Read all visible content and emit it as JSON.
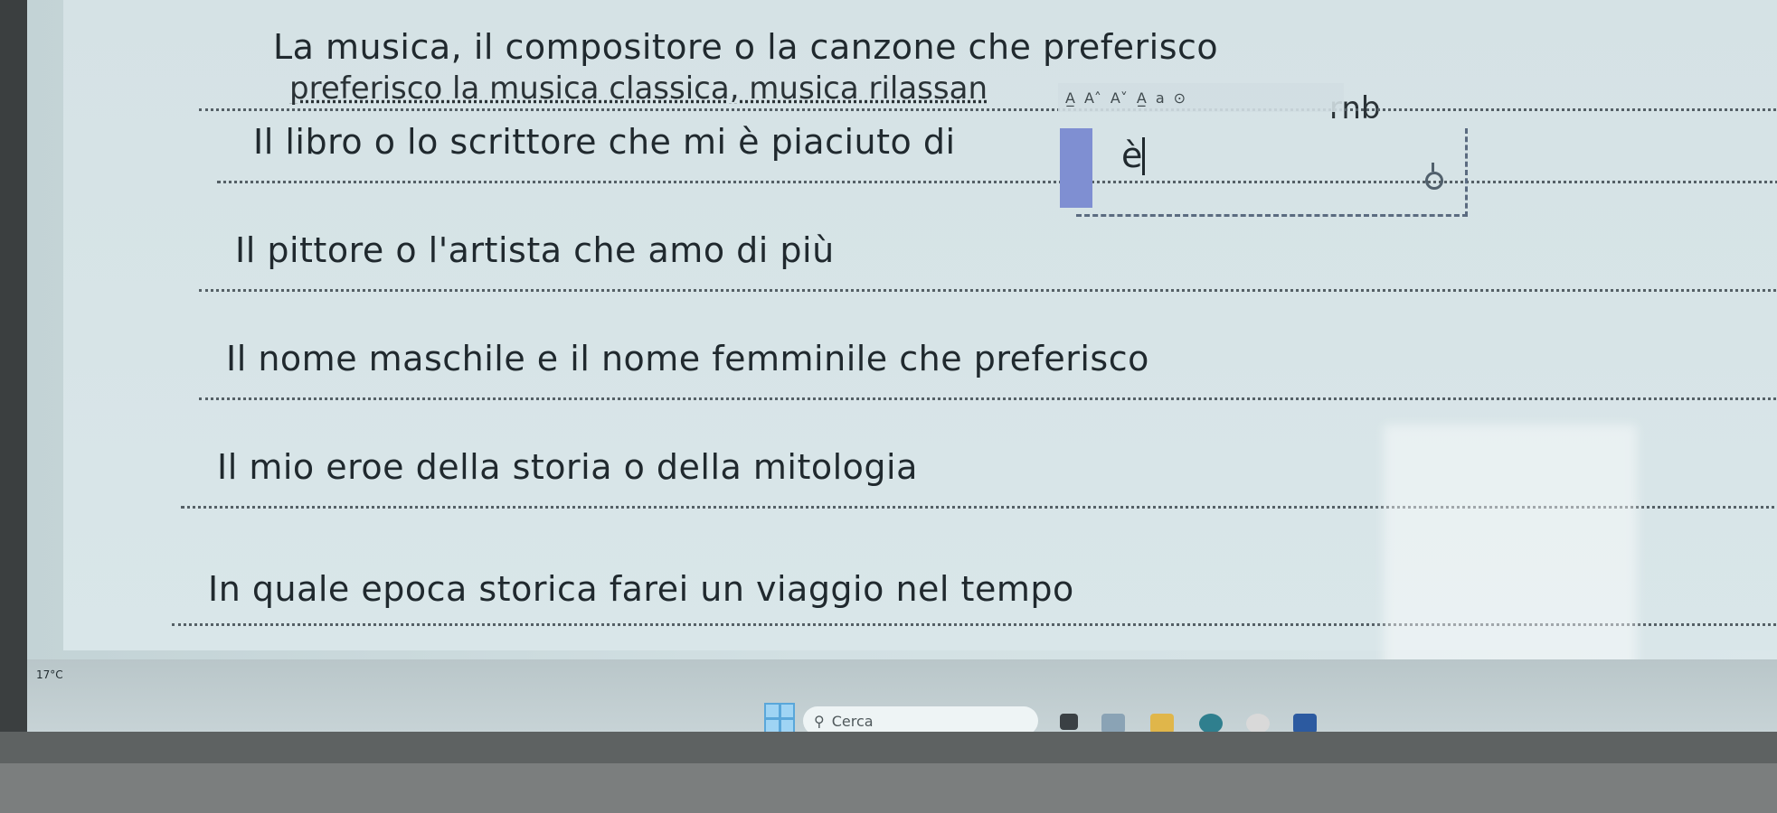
{
  "document": {
    "questions": [
      "La musica, il compositore o la canzone che preferisco",
      "Il libro o lo scrittore che mi è piaciuto di",
      "Il pittore o l'artista che amo di più",
      "Il nome maschile e il nome femminile che preferisco",
      "Il mio eroe della storia o della mitologia",
      "In quale epoca storica farei un viaggio nel tempo"
    ],
    "answers": [
      "preferisco la musica classica, musica rilassan",
      "rnb"
    ],
    "cursor_text": "è"
  },
  "toolbar": {
    "items": [
      "A̲",
      "A˄",
      "A˅",
      "A̲̲",
      "a",
      "⊙"
    ]
  },
  "taskbar": {
    "search_placeholder": "Cerca",
    "weather": "17°C"
  },
  "colors": {
    "selection": "#7f8fd2",
    "taskbar": "#c7d3d6",
    "text": "#20292e"
  }
}
